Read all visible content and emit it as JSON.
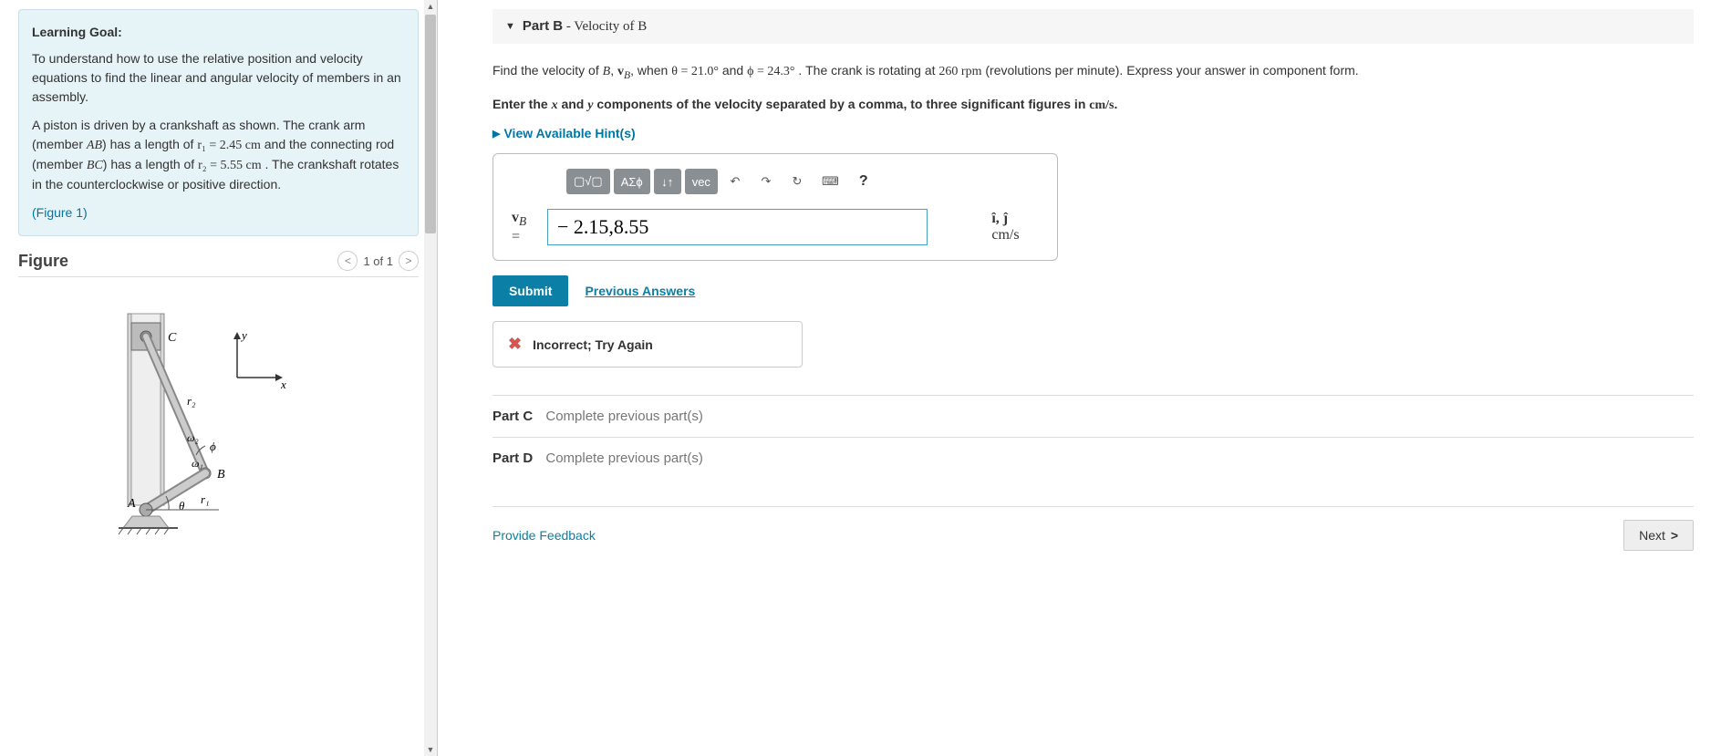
{
  "left": {
    "goal_title": "Learning Goal:",
    "goal_text": "To understand how to use the relative position and velocity equations to find the linear and angular velocity of members in an assembly.",
    "problem_p1_a": "A piston is driven by a crankshaft as shown. The crank arm (member ",
    "problem_p1_ab": "AB",
    "problem_p1_b": ") has a length of ",
    "problem_p1_r1": "r₁ = 2.45 cm",
    "problem_p1_c": " and the connecting rod (member ",
    "problem_p1_bc": "BC",
    "problem_p1_d": ") has a length of ",
    "problem_p1_r2": "r₂ = 5.55 cm",
    "problem_p1_e": " . The crankshaft rotates in the counterclockwise or positive direction.",
    "figure_link": "(Figure 1)",
    "figure_title": "Figure",
    "pager_text": "1 of 1"
  },
  "right": {
    "part_b_label": "Part B",
    "part_b_title": " - Velocity of B",
    "question_a": "Find the velocity of ",
    "question_b": ", when ",
    "question_theta": "θ = 21.0°",
    "question_c": " and ",
    "question_phi": "ϕ = 24.3°",
    "question_d": " . The crank is rotating at ",
    "question_rpm": "260 rpm",
    "question_e": " (revolutions per minute). Express your answer in component form.",
    "instruction_a": "Enter the ",
    "instruction_b": " and ",
    "instruction_c": " components of the velocity separated by a comma, to three significant figures in ",
    "instruction_unit": "cm/s",
    "instruction_d": ".",
    "hints": "View Available Hint(s)",
    "toolbar": {
      "templates": "▢√▢",
      "greek": "ΑΣϕ",
      "subscript": "↓↑",
      "vec": "vec",
      "undo": "↶",
      "redo": "↷",
      "reset": "↻",
      "keyboard": "⌨",
      "help": "?"
    },
    "input_label_a": "v",
    "input_label_b": "B",
    "input_label_eq": " = ",
    "answer_value": "− 2.15,8.55",
    "unit_a": "î, ĵ ",
    "unit_b": "cm/s",
    "submit": "Submit",
    "prev_answers": "Previous Answers",
    "feedback": "Incorrect; Try Again",
    "part_c_label": "Part C",
    "part_c_sub": "Complete previous part(s)",
    "part_d_label": "Part D",
    "part_d_sub": "Complete previous part(s)",
    "provide_feedback": "Provide Feedback",
    "next": "Next"
  }
}
